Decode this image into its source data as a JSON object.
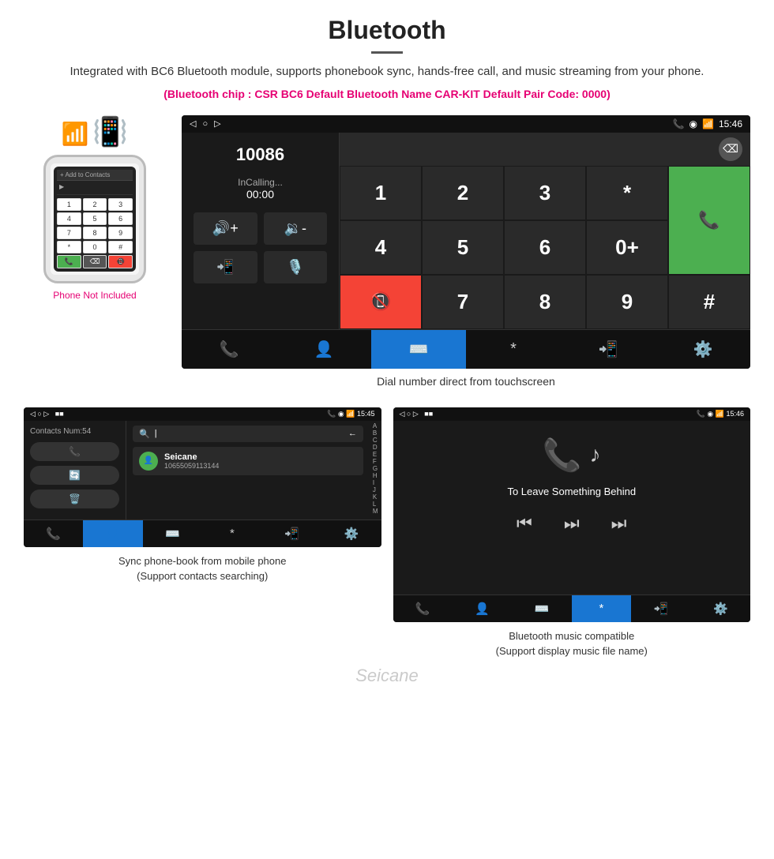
{
  "header": {
    "title": "Bluetooth",
    "description": "Integrated with BC6 Bluetooth module, supports phonebook sync, hands-free call, and music streaming from your phone.",
    "chip_info": "(Bluetooth chip : CSR BC6    Default Bluetooth Name CAR-KIT    Default Pair Code: 0000)"
  },
  "phone_label": "Phone Not Included",
  "dial_screen": {
    "status_bar": {
      "time": "15:46",
      "icons_left": [
        "◁",
        "□",
        "▷"
      ],
      "icons_right": [
        "📞",
        "◉",
        "📶"
      ]
    },
    "number": "10086",
    "calling_label": "InCalling...",
    "calling_time": "00:00",
    "keys": [
      "1",
      "2",
      "3",
      "*",
      "4",
      "5",
      "6",
      "0+",
      "7",
      "8",
      "9",
      "#"
    ],
    "green_btn": "📞",
    "red_btn": "📞",
    "backspace": "⌫"
  },
  "dial_caption": "Dial number direct from touchscreen",
  "contacts_screen": {
    "status_bar_time": "15:45",
    "contacts_num": "Contacts Num:54",
    "search_placeholder": "🔍",
    "contact_name": "Seicane",
    "contact_number": "10655059113144",
    "alpha_list": [
      "A",
      "B",
      "C",
      "D",
      "E",
      "F",
      "G",
      "H",
      "I",
      "J",
      "K",
      "L",
      "M"
    ]
  },
  "contacts_caption_line1": "Sync phone-book from mobile phone",
  "contacts_caption_line2": "(Support contacts searching)",
  "music_screen": {
    "status_bar_time": "15:46",
    "song_title": "To Leave Something Behind"
  },
  "music_caption_line1": "Bluetooth music compatible",
  "music_caption_line2": "(Support display music file name)",
  "watermark": "Seicane"
}
